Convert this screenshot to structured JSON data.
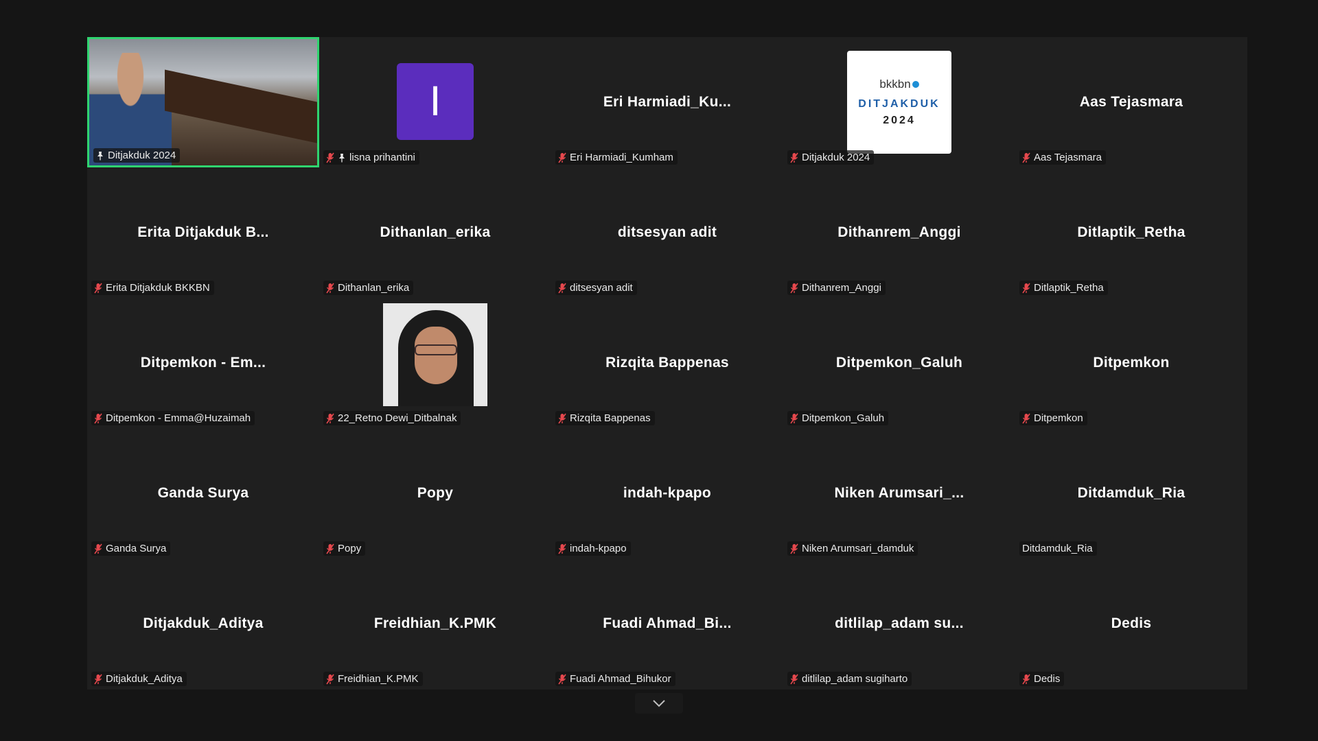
{
  "tiles": [
    {
      "display": "",
      "label": "Ditjakduk 2024",
      "type": "video-room",
      "pinned": true,
      "muted": false,
      "active": true
    },
    {
      "display": "I",
      "label": "lisna prihantini",
      "type": "letter",
      "pinned": true,
      "muted": true,
      "avatar_color": "#5b2dbd"
    },
    {
      "display": "Eri  Harmiadi_Ku...",
      "label": "Eri Harmiadi_Kumham",
      "type": "name",
      "muted": true
    },
    {
      "display": "",
      "label": "Ditjakduk 2024",
      "type": "logo",
      "muted": true,
      "logo": {
        "brand": "bkkbn",
        "title": "DITJAKDUK",
        "year": "2024"
      }
    },
    {
      "display": "Aas Tejasmara",
      "label": "Aas Tejasmara",
      "type": "name",
      "muted": true
    },
    {
      "display": "Erita  Ditjakduk  B...",
      "label": "Erita Ditjakduk BKKBN",
      "type": "name",
      "muted": true
    },
    {
      "display": "Dithanlan_erika",
      "label": "Dithanlan_erika",
      "type": "name",
      "muted": true
    },
    {
      "display": "ditsesyan adit",
      "label": "ditsesyan adit",
      "type": "name",
      "muted": true
    },
    {
      "display": "Dithanrem_Anggi",
      "label": "Dithanrem_Anggi",
      "type": "name",
      "muted": true
    },
    {
      "display": "Ditlaptik_Retha",
      "label": "Ditlaptik_Retha",
      "type": "name",
      "muted": true
    },
    {
      "display": "Ditpemkon  -  Em...",
      "label": "Ditpemkon - Emma@Huzaimah",
      "type": "name",
      "muted": true
    },
    {
      "display": "",
      "label": "22_Retno Dewi_Ditbalnak",
      "type": "photo-face",
      "muted": true
    },
    {
      "display": "Rizqita Bappenas",
      "label": "Rizqita Bappenas",
      "type": "name",
      "muted": true
    },
    {
      "display": "Ditpemkon_Galuh",
      "label": "Ditpemkon_Galuh",
      "type": "name",
      "muted": true
    },
    {
      "display": "Ditpemkon",
      "label": "Ditpemkon",
      "type": "name",
      "muted": true
    },
    {
      "display": "Ganda Surya",
      "label": "Ganda Surya",
      "type": "name",
      "muted": true
    },
    {
      "display": "Popy",
      "label": "Popy",
      "type": "name",
      "muted": true
    },
    {
      "display": "indah-kpapo",
      "label": "indah-kpapo",
      "type": "name",
      "muted": true
    },
    {
      "display": "Niken  Arumsari_...",
      "label": "Niken Arumsari_damduk",
      "type": "name",
      "muted": true
    },
    {
      "display": "Ditdamduk_Ria",
      "label": "Ditdamduk_Ria",
      "type": "name",
      "muted": false
    },
    {
      "display": "Ditjakduk_Aditya",
      "label": "Ditjakduk_Aditya",
      "type": "name",
      "muted": true
    },
    {
      "display": "Freidhian_K.PMK",
      "label": "Freidhian_K.PMK",
      "type": "name",
      "muted": true
    },
    {
      "display": "Fuadi  Ahmad_Bi...",
      "label": "Fuadi Ahmad_Bihukor",
      "type": "name",
      "muted": true
    },
    {
      "display": "ditlilap_adam  su...",
      "label": "ditlilap_adam sugiharto",
      "type": "name",
      "muted": true
    },
    {
      "display": "Dedis",
      "label": "Dedis",
      "type": "name",
      "muted": true
    }
  ],
  "icons": {
    "muted": "mic-off-icon",
    "pinned": "pin-icon",
    "scroll": "chevron-down-icon"
  },
  "colors": {
    "active_speaker_border": "#2fd46f",
    "mic_off": "#e5484d",
    "tile_bg": "#1f1f1f",
    "page_bg": "#151515"
  }
}
